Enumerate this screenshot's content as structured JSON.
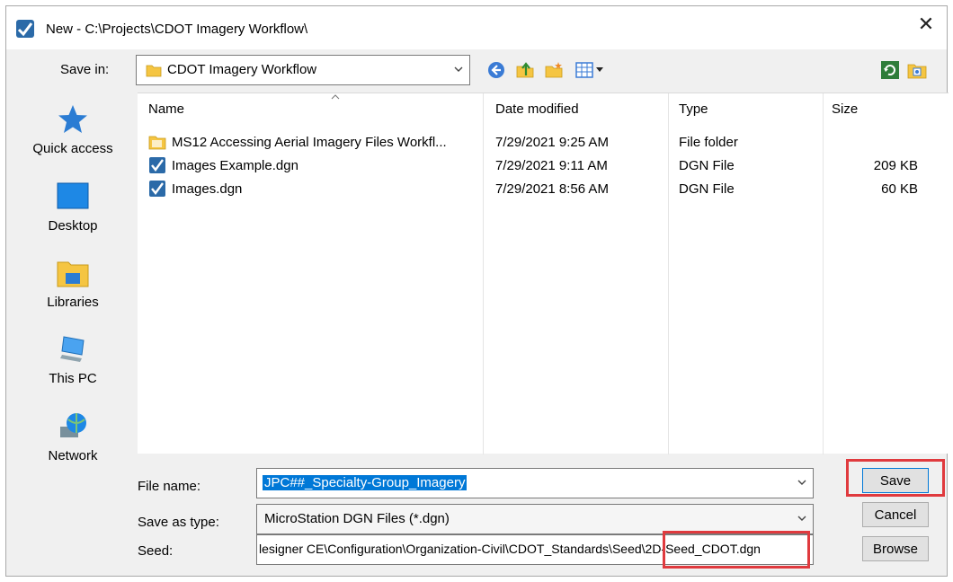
{
  "window": {
    "title": "New - C:\\Projects\\CDOT Imagery Workflow\\",
    "close_glyph": "✕"
  },
  "savein": {
    "label": "Save in:",
    "value": "CDOT Imagery Workflow"
  },
  "toolbar": {
    "icons": [
      "back-icon",
      "up-folder-icon",
      "new-folder-icon",
      "view-menu-icon"
    ],
    "right_icons": [
      "refresh-icon",
      "favorites-icon"
    ]
  },
  "places": [
    {
      "label": "Quick access",
      "icon": "star-icon"
    },
    {
      "label": "Desktop",
      "icon": "desktop-icon"
    },
    {
      "label": "Libraries",
      "icon": "libraries-icon"
    },
    {
      "label": "This PC",
      "icon": "computer-icon"
    },
    {
      "label": "Network",
      "icon": "network-icon"
    }
  ],
  "filelist": {
    "columns": [
      "Name",
      "Date modified",
      "Type",
      "Size"
    ],
    "rows": [
      {
        "name": "MS12 Accessing Aerial Imagery Files Workfl...",
        "date": "7/29/2021 9:25 AM",
        "type": "File folder",
        "size": "",
        "icon": "folder-icon"
      },
      {
        "name": "Images Example.dgn",
        "date": "7/29/2021 9:11 AM",
        "type": "DGN File",
        "size": "209 KB",
        "icon": "dgn-file-icon"
      },
      {
        "name": "Images.dgn",
        "date": "7/29/2021 8:56 AM",
        "type": "DGN File",
        "size": "60 KB",
        "icon": "dgn-file-icon"
      }
    ]
  },
  "form": {
    "filename_label": "File name:",
    "filename_value": "JPC##_Specialty-Group_Imagery",
    "type_label": "Save as type:",
    "type_value": "MicroStation DGN Files (*.dgn)",
    "seed_label": "Seed:",
    "seed_value": "lesigner CE\\Configuration\\Organization-Civil\\CDOT_Standards\\Seed\\2D-Seed_CDOT.dgn"
  },
  "buttons": {
    "save": "Save",
    "cancel": "Cancel",
    "browse": "Browse"
  },
  "colors": {
    "highlight": "#e03a3e",
    "selection": "#0078d7"
  }
}
